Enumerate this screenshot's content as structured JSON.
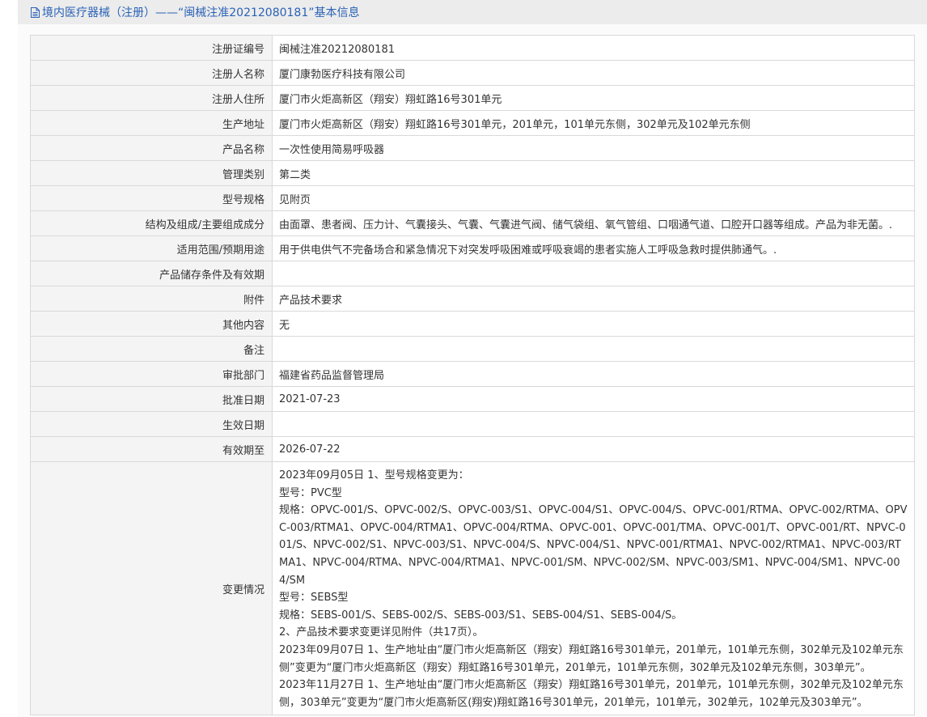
{
  "title": {
    "icon": "document-icon",
    "text": "境内医疗器械（注册）——“闽械注准20212080181”基本信息"
  },
  "rows": [
    {
      "label": "注册证编号",
      "value": "闽械注准20212080181"
    },
    {
      "label": "注册人名称",
      "value": "厦门康勃医疗科技有限公司"
    },
    {
      "label": "注册人住所",
      "value": "厦门市火炬高新区（翔安）翔虹路16号301单元"
    },
    {
      "label": "生产地址",
      "value": "厦门市火炬高新区（翔安）翔虹路16号301单元，201单元，101单元东侧，302单元及102单元东侧"
    },
    {
      "label": "产品名称",
      "value": "一次性使用简易呼吸器"
    },
    {
      "label": "管理类别",
      "value": "第二类"
    },
    {
      "label": "型号规格",
      "value": "见附页"
    },
    {
      "label": "结构及组成/主要组成成分",
      "value": "由面罩、患者阀、压力计、气囊接头、气囊、气囊进气阀、储气袋组、氧气管组、口咽通气道、口腔开口器等组成。产品为非无菌。."
    },
    {
      "label": "适用范围/预期用途",
      "value": "用于供电供气不完备场合和紧急情况下对突发呼吸困难或呼吸衰竭的患者实施人工呼吸急救时提供肺通气。."
    },
    {
      "label": "产品储存条件及有效期",
      "value": ""
    },
    {
      "label": "附件",
      "value": "产品技术要求"
    },
    {
      "label": "其他内容",
      "value": "无"
    },
    {
      "label": "备注",
      "value": ""
    },
    {
      "label": "审批部门",
      "value": "福建省药品监督管理局"
    },
    {
      "label": "批准日期",
      "value": "2021-07-23"
    },
    {
      "label": "生效日期",
      "value": ""
    },
    {
      "label": "有效期至",
      "value": "2026-07-22"
    }
  ],
  "changes": {
    "label": "变更情况",
    "lines": [
      "2023年09月05日 1、型号规格变更为：",
      "型号：PVC型",
      "规格：OPVC-001/S、OPVC-002/S、OPVC-003/S1、OPVC-004/S1、OPVC-004/S、OPVC-001/RTMA、OPVC-002/RTMA、OPVC-003/RTMA1、OPVC-004/RTMA1、OPVC-004/RTMA、OPVC-001、OPVC-001/TMA、OPVC-001/T、OPVC-001/RT、NPVC-001/S、NPVC-002/S1、NPVC-003/S1、NPVC-004/S、NPVC-004/S1、NPVC-001/RTMA1、NPVC-002/RTMA1、NPVC-003/RTMA1、NPVC-004/RTMA、NPVC-004/RTMA1、NPVC-001/SM、NPVC-002/SM、NPVC-003/SM1、NPVC-004/SM1、NPVC-004/SM",
      "型号：SEBS型",
      "规格：SEBS-001/S、SEBS-002/S、SEBS-003/S1、SEBS-004/S1、SEBS-004/S。",
      "2、产品技术要求变更详见附件（共17页）。",
      "2023年09月07日 1、生产地址由“厦门市火炬高新区（翔安）翔虹路16号301单元，201单元，101单元东侧，302单元及102单元东侧”变更为“厦门市火炬高新区（翔安）翔虹路16号301单元，201单元，101单元东侧，302单元及102单元东侧，303单元”。",
      "2023年11月27日 1、生产地址由“厦门市火炬高新区（翔安）翔虹路16号301单元，201单元，101单元东侧，302单元及102单元东侧，303单元”变更为“厦门市火炬高新区(翔安)翔虹路16号301单元，201单元，101单元，302单元，102单元及303单元”。"
    ]
  },
  "colors": {
    "title_text": "#2a62b6",
    "title_bg": "#ececec",
    "label_bg": "#f4f4f4",
    "border": "#d9d9d9"
  }
}
